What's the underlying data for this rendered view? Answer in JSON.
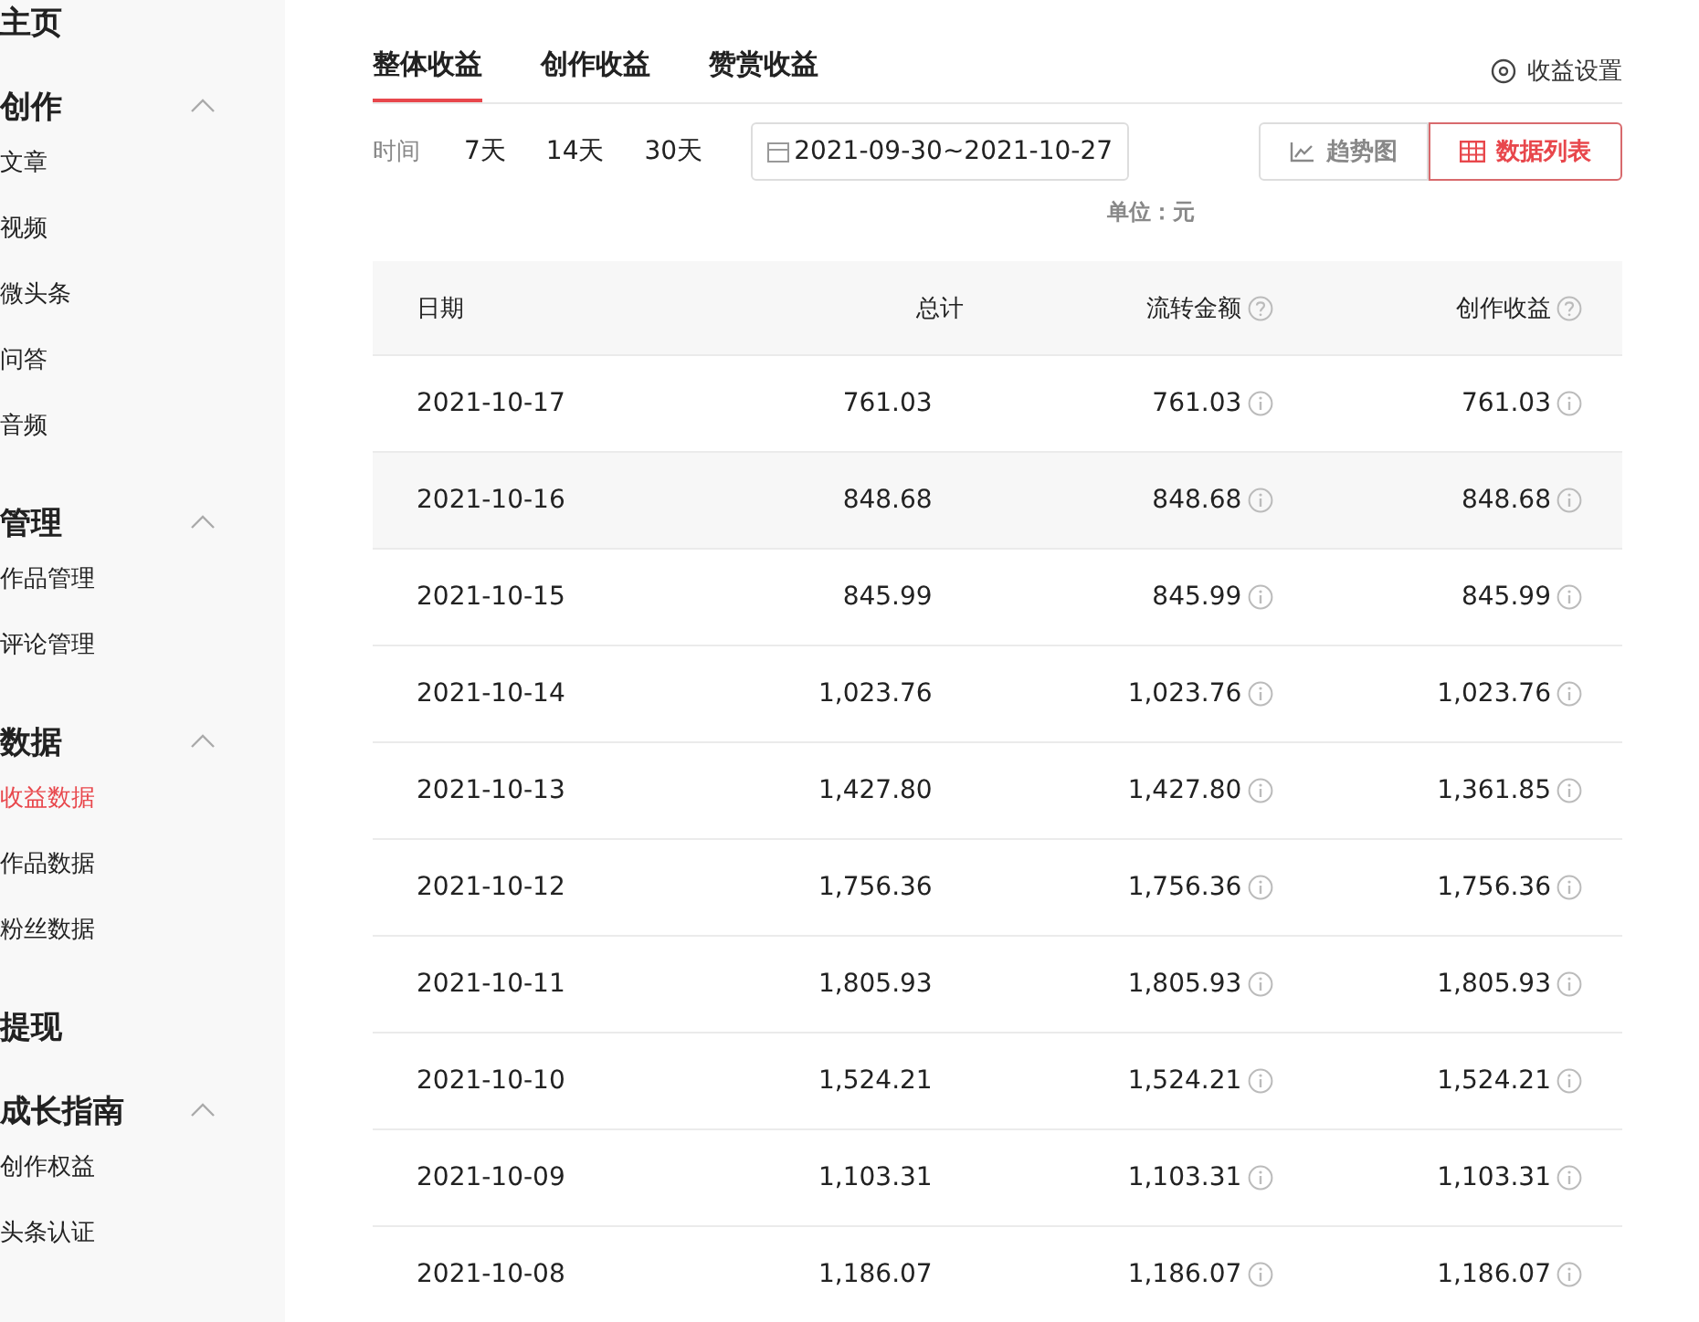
{
  "sidebar": {
    "groups": [
      {
        "label": "主页"
      },
      {
        "label": "创作",
        "expanded": true,
        "items": [
          {
            "label": "文章",
            "selected": false
          },
          {
            "label": "视频",
            "selected": false
          },
          {
            "label": "微头条",
            "selected": false
          },
          {
            "label": "问答",
            "selected": false
          },
          {
            "label": "音频",
            "selected": false
          }
        ]
      },
      {
        "label": "管理",
        "expanded": true,
        "items": [
          {
            "label": "作品管理",
            "selected": false
          },
          {
            "label": "评论管理",
            "selected": false
          }
        ]
      },
      {
        "label": "数据",
        "expanded": true,
        "items": [
          {
            "label": "收益数据",
            "selected": true
          },
          {
            "label": "作品数据",
            "selected": false
          },
          {
            "label": "粉丝数据",
            "selected": false
          }
        ]
      },
      {
        "label": "提现"
      },
      {
        "label": "成长指南",
        "expanded": true,
        "items": [
          {
            "label": "创作权益",
            "selected": false
          },
          {
            "label": "头条认证",
            "selected": false
          }
        ]
      }
    ]
  },
  "tabs": [
    {
      "label": "整体收益",
      "selected": true
    },
    {
      "label": "创作收益",
      "selected": false
    },
    {
      "label": "赞赏收益",
      "selected": false
    }
  ],
  "settings_link": "收益设置",
  "filter": {
    "label": "时间",
    "ranges": [
      {
        "label": "7天",
        "selected": false
      },
      {
        "label": "14天",
        "selected": false
      },
      {
        "label": "30天",
        "selected": false
      }
    ],
    "date_range": "2021-09-30~2021-10-27"
  },
  "views": [
    {
      "label": "趋势图",
      "kind": "chart",
      "selected": false
    },
    {
      "label": "数据列表",
      "kind": "table",
      "selected": true
    }
  ],
  "unit": "单位：元",
  "table": {
    "columns": [
      {
        "label": "日期",
        "help": false
      },
      {
        "label": "总计",
        "help": false
      },
      {
        "label": "流转金额",
        "help": true
      },
      {
        "label": "创作收益",
        "help": true
      }
    ],
    "rows": [
      {
        "hovered": false,
        "cells": [
          "2021-10-17",
          "761.03",
          "761.03",
          "761.03"
        ]
      },
      {
        "hovered": true,
        "cells": [
          "2021-10-16",
          "848.68",
          "848.68",
          "848.68"
        ]
      },
      {
        "hovered": false,
        "cells": [
          "2021-10-15",
          "845.99",
          "845.99",
          "845.99"
        ]
      },
      {
        "hovered": false,
        "cells": [
          "2021-10-14",
          "1,023.76",
          "1,023.76",
          "1,023.76"
        ]
      },
      {
        "hovered": false,
        "cells": [
          "2021-10-13",
          "1,427.80",
          "1,427.80",
          "1,361.85"
        ]
      },
      {
        "hovered": false,
        "cells": [
          "2021-10-12",
          "1,756.36",
          "1,756.36",
          "1,756.36"
        ]
      },
      {
        "hovered": false,
        "cells": [
          "2021-10-11",
          "1,805.93",
          "1,805.93",
          "1,805.93"
        ]
      },
      {
        "hovered": false,
        "cells": [
          "2021-10-10",
          "1,524.21",
          "1,524.21",
          "1,524.21"
        ]
      },
      {
        "hovered": false,
        "cells": [
          "2021-10-09",
          "1,103.31",
          "1,103.31",
          "1,103.31"
        ]
      },
      {
        "hovered": false,
        "cells": [
          "2021-10-08",
          "1,186.07",
          "1,186.07",
          "1,186.07"
        ]
      }
    ]
  }
}
